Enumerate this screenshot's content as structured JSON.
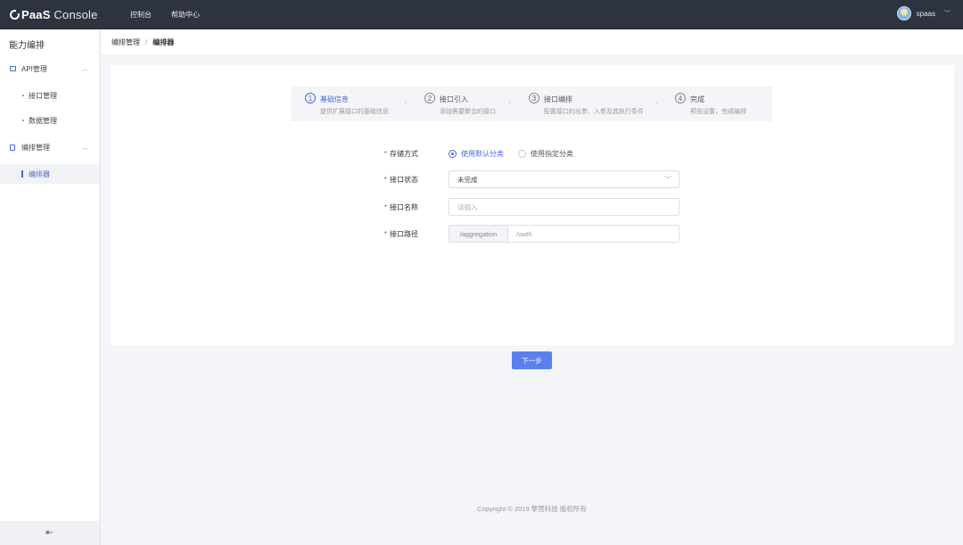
{
  "app": {
    "brand_bold": "PaaS",
    "brand_rest": " Console"
  },
  "top_nav": [
    "控制台",
    "帮助中心"
  ],
  "user": {
    "name": "spaas"
  },
  "sidebar": {
    "title": "能力编排",
    "groups": [
      {
        "label": "API管理",
        "items": [
          "接口管理",
          "数据管理"
        ]
      },
      {
        "label": "编排管理",
        "items": [
          "编排器"
        ]
      }
    ],
    "active_item": "编排器"
  },
  "breadcrumb": [
    "编排管理",
    "编排器"
  ],
  "steps": [
    {
      "num": "1",
      "title": "基础信息",
      "desc": "提供扩展接口的基础信息"
    },
    {
      "num": "2",
      "title": "接口引入",
      "desc": "添加需要聚合的接口"
    },
    {
      "num": "3",
      "title": "接口编排",
      "desc": "配置接口的出参、入参及其执行条件"
    },
    {
      "num": "4",
      "title": "完成",
      "desc": "预览设置，完成编排"
    }
  ],
  "form": {
    "storage": {
      "label": "存储方式",
      "options": [
        "使用默认分类",
        "使用指定分类"
      ],
      "selected": "使用默认分类"
    },
    "status": {
      "label": "接口状态",
      "value": "未完成"
    },
    "name": {
      "label": "接口名称",
      "placeholder": "请输入"
    },
    "path": {
      "label": "接口路径",
      "prefix": "/aggregation",
      "value": "/swth"
    }
  },
  "next_button": "下一步",
  "footer": {
    "copyright": "Copyright © 2019 擎营科技 版权所有"
  },
  "colors": {
    "topbar": "#2e3340",
    "accent": "#4a6bd8",
    "button": "#5b80ee"
  }
}
